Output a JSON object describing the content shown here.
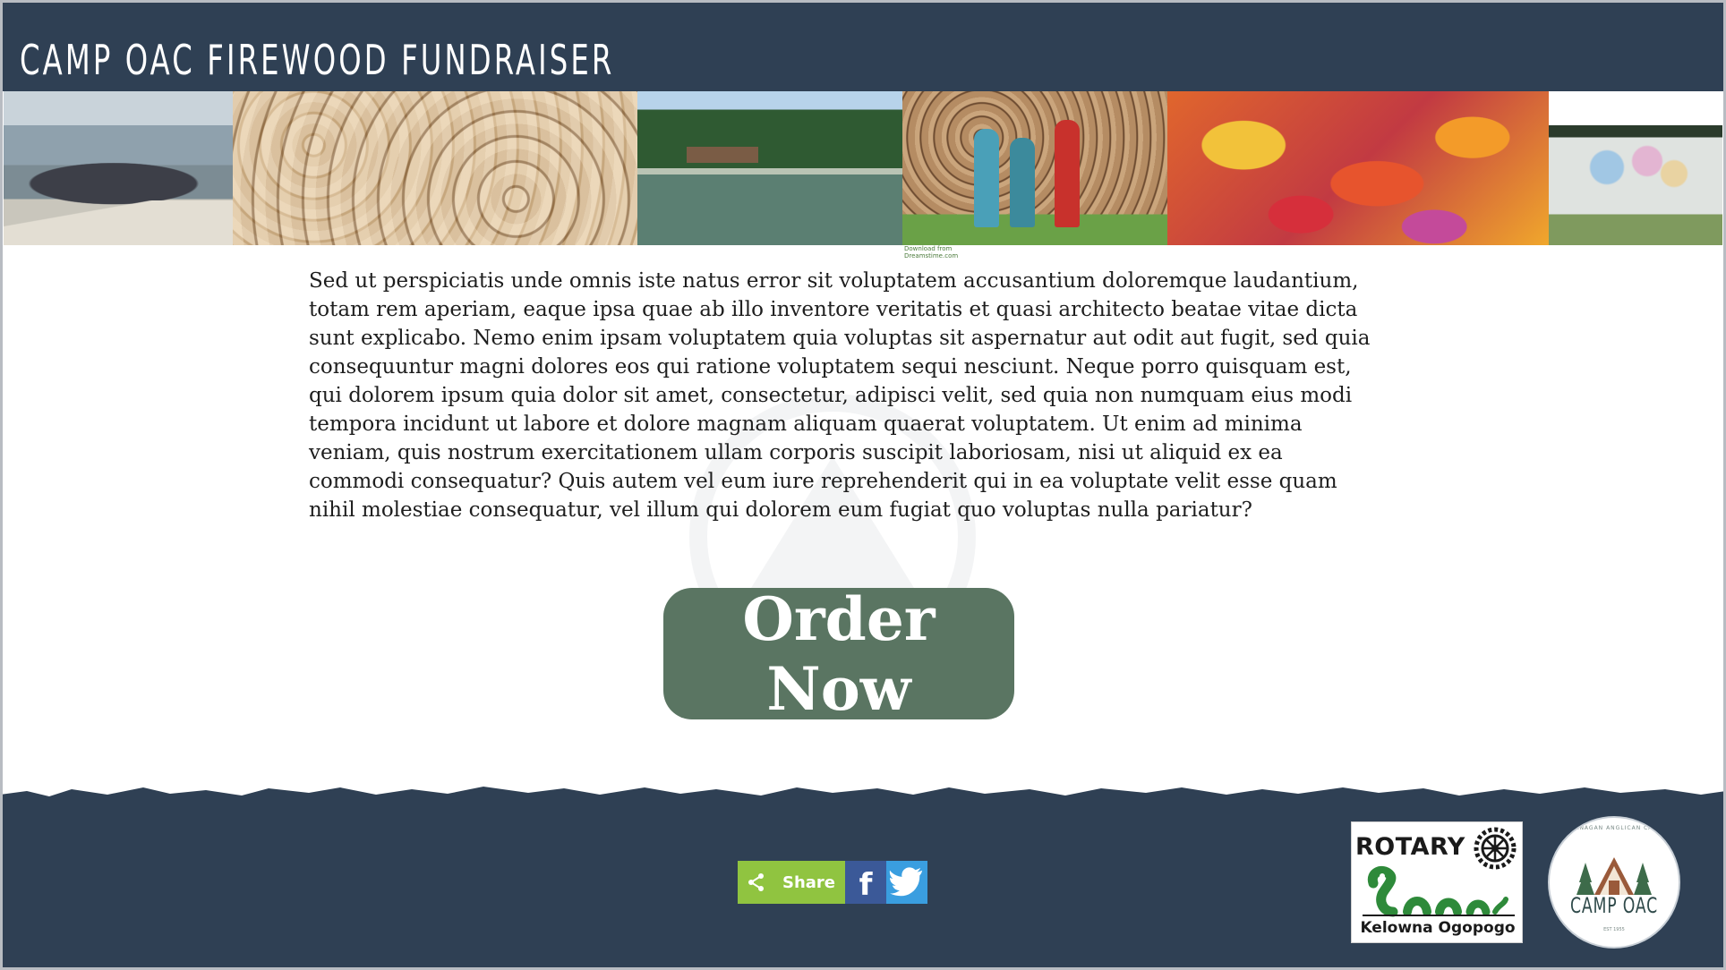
{
  "header": {
    "title": "Camp OAC Firewood Fundraiser"
  },
  "photo_strip": {
    "images": [
      "group-photo-on-dock",
      "stacked-firewood",
      "lake-and-forest",
      "people-stacking-firewood",
      "autumn-maple-leaves",
      "painted-camp-wall"
    ],
    "stock_stamp": "Download from Dreamstime.com"
  },
  "main": {
    "body_text": "Sed ut  perspiciatis unde  omnis iste natus error sit  voluptatem accusantium doloremque  laudantium, totam  rem aperiam, eaque ipsa quae  ab illo  inventore veritatis  et quasi architecto  beatae  vitae dicta sunt explicabo.  Nemo enim ipsam voluptatem quia voluptas sit aspernatur aut odit aut fugit, sed quia consequuntur magni dolores eos qui ratione voluptatem sequi nesciunt. Neque porro quisquam est, qui dolorem ipsum quia dolor sit amet, consectetur, adipisci velit, sed quia non numquam eius modi tempora incidunt ut  labore et dolore  magnam aliquam  quaerat voluptatem.  Ut enim ad minima  veniam, quis nostrum exercitationem ullam corporis suscipit laboriosam, nisi ut aliquid ex ea commodi consequatur? Quis autem vel eum iure reprehenderit qui in ea voluptate velit esse quam nihil molestiae consequatur, vel illum qui dolorem eum fugiat quo voluptas nulla pariatur?",
    "order_button_label": "Order Now"
  },
  "footer": {
    "share_label": "Share",
    "facebook_glyph": "f",
    "rotary": {
      "word": "ROTARY",
      "club": "Kelowna Ogopogo"
    },
    "camp": {
      "arc_text": "OKANAGAN ANGLICAN CAMP",
      "name": "CAMP OAC",
      "est": "EST 1955"
    }
  },
  "colors": {
    "header_bg": "#2f4054",
    "button_bg": "#5a7562",
    "share_green": "#90c440",
    "facebook_blue": "#3b5998",
    "twitter_blue": "#3a9ee0"
  }
}
